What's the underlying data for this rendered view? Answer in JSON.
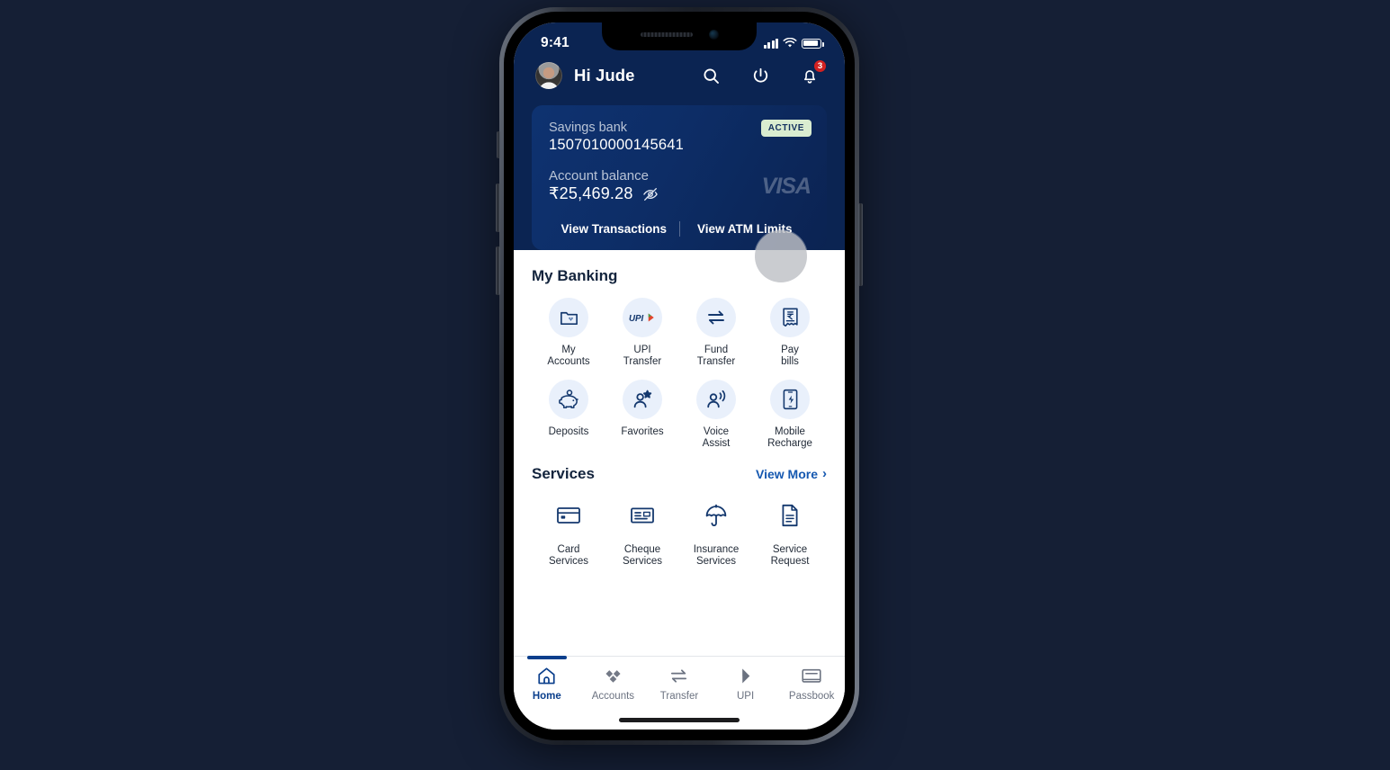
{
  "status_bar": {
    "time": "9:41",
    "signal_icon": "cellular-signal-icon",
    "wifi_icon": "wifi-icon",
    "battery_icon": "battery-icon"
  },
  "header": {
    "greeting": "Hi Jude",
    "avatar_name": "user-avatar",
    "search_icon": "search-icon",
    "power_icon": "power-icon",
    "bell_icon": "notification-bell-icon",
    "notification_count": "3",
    "background_color": "#0b2452"
  },
  "account_card": {
    "account_type": "Savings bank",
    "account_number": "1507010000145641",
    "balance_label": "Account balance",
    "balance": "₹25,469.28",
    "hide_balance_icon": "eye-off-icon",
    "status": "ACTIVE",
    "status_bg_color": "#d9ecd0",
    "network_logo": "VISA",
    "actions": [
      {
        "label": "View Transactions"
      },
      {
        "label": "View ATM Limits"
      }
    ]
  },
  "my_banking": {
    "title": "My Banking",
    "tiles": [
      {
        "label": "My\nAccounts",
        "icon": "folder-accounts-icon"
      },
      {
        "label": "UPI\nTransfer",
        "icon": "upi-icon"
      },
      {
        "label": "Fund\nTransfer",
        "icon": "transfer-arrows-icon"
      },
      {
        "label": "Pay\nbills",
        "icon": "bill-receipt-icon"
      },
      {
        "label": "Deposits",
        "icon": "piggy-bank-icon"
      },
      {
        "label": "Favorites",
        "icon": "person-star-icon"
      },
      {
        "label": "Voice\nAssist",
        "icon": "person-voice-icon"
      },
      {
        "label": "Mobile\nRecharge",
        "icon": "phone-bolt-icon"
      }
    ]
  },
  "services": {
    "title": "Services",
    "view_more_label": "View More",
    "view_more_chevron": "chevron-right-icon",
    "accent_color": "#1558b0",
    "tiles": [
      {
        "label": "Card\nServices",
        "icon": "credit-card-icon"
      },
      {
        "label": "Cheque\nServices",
        "icon": "cheque-icon"
      },
      {
        "label": "Insurance\nServices",
        "icon": "umbrella-icon"
      },
      {
        "label": "Service\nRequest",
        "icon": "document-icon"
      }
    ]
  },
  "bottom_nav": {
    "active_color": "#0b3f8c",
    "items": [
      {
        "label": "Home",
        "icon": "home-icon",
        "active": true
      },
      {
        "label": "Accounts",
        "icon": "accounts-diamond-icon",
        "active": false
      },
      {
        "label": "Transfer",
        "icon": "transfer-arrows-icon",
        "active": false
      },
      {
        "label": "UPI",
        "icon": "upi-arrow-icon",
        "active": false
      },
      {
        "label": "Passbook",
        "icon": "passbook-icon",
        "active": false
      }
    ]
  },
  "cursor": {
    "name": "touch-cursor-overlay"
  }
}
